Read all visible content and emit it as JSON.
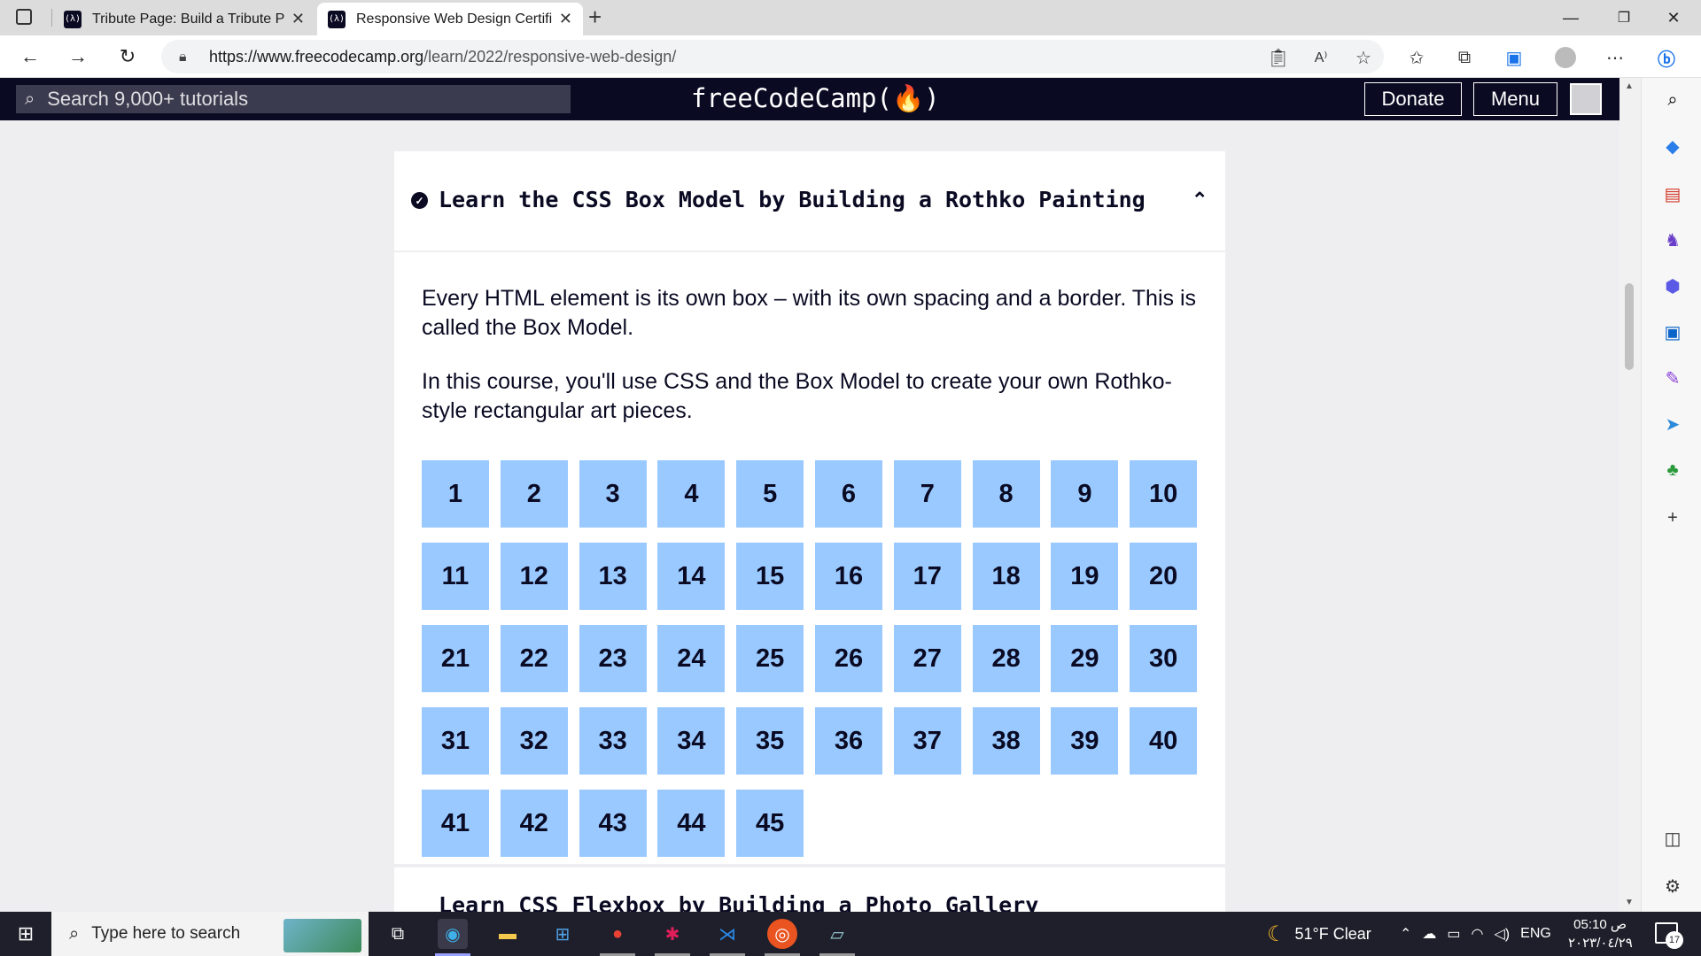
{
  "browser": {
    "tabs": [
      {
        "label": "Tribute Page: Build a Tribute Page",
        "active": false
      },
      {
        "label": "Responsive Web Design Certifica",
        "active": true
      }
    ],
    "new_tab_icon": "plus-icon",
    "url": {
      "host": "https://www.freecodecamp.org",
      "path": "/learn/2022/responsive-web-design/"
    }
  },
  "fcc": {
    "search_placeholder": "Search 9,000+ tutorials",
    "logo": "freeCodeCamp(🔥)",
    "donate_label": "Donate",
    "menu_label": "Menu"
  },
  "block": {
    "title": "Learn the CSS Box Model by Building a Rothko Painting",
    "completed": true,
    "para1": "Every HTML element is its own box – with its own spacing and a border. This is called the Box Model.",
    "para2": "In this course, you'll use CSS and the Box Model to create your own Rothko-style rectangular art pieces.",
    "steps": [
      "1",
      "2",
      "3",
      "4",
      "5",
      "6",
      "7",
      "8",
      "9",
      "10",
      "11",
      "12",
      "13",
      "14",
      "15",
      "16",
      "17",
      "18",
      "19",
      "20",
      "21",
      "22",
      "23",
      "24",
      "25",
      "26",
      "27",
      "28",
      "29",
      "30",
      "31",
      "32",
      "33",
      "34",
      "35",
      "36",
      "37",
      "38",
      "39",
      "40",
      "41",
      "42",
      "43",
      "44",
      "45"
    ]
  },
  "next_block": {
    "title_partial": "Learn CSS Flexbox by Building a Photo Gallery"
  },
  "taskbar": {
    "search_placeholder": "Type here to search",
    "weather": "51°F  Clear",
    "language": "ENG",
    "time": "05:10 ص",
    "date": "٢٠٢٣/٠٤/٢٩",
    "notification_count": "17"
  },
  "colors": {
    "fcc_dark": "#0a0a23",
    "step_blue": "#99c9ff",
    "page_bg": "#eeeef0"
  }
}
